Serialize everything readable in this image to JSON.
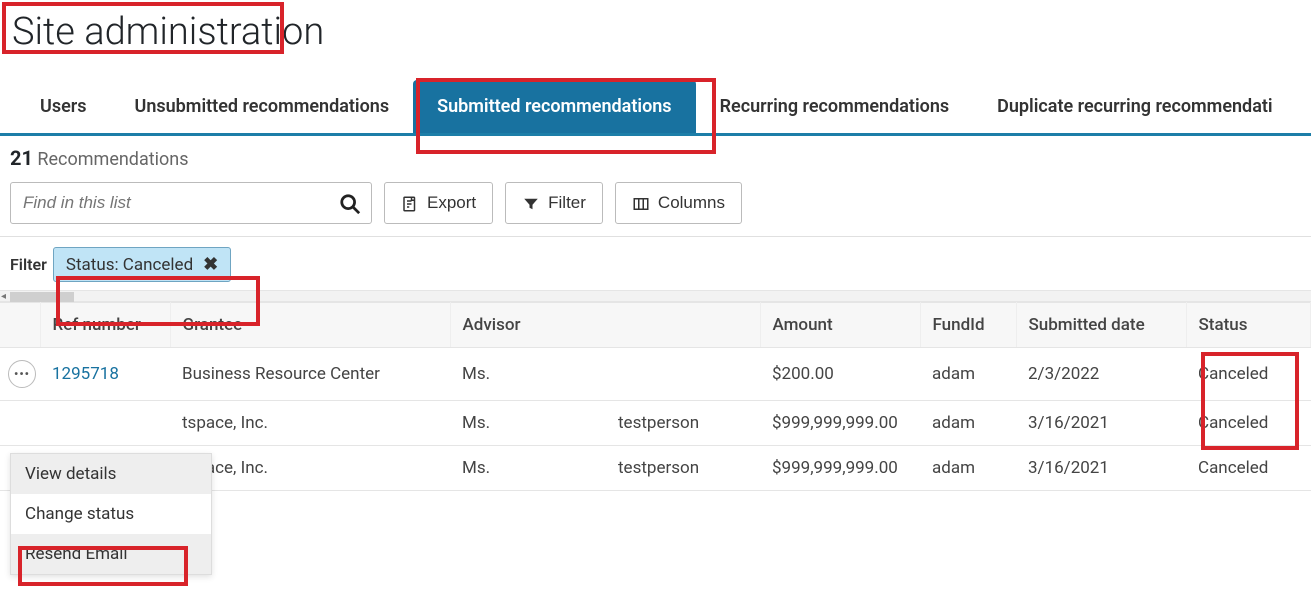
{
  "page": {
    "title": "Site administration"
  },
  "tabs": [
    {
      "label": "Users"
    },
    {
      "label": "Unsubmitted recommendations"
    },
    {
      "label": "Submitted recommendations"
    },
    {
      "label": "Recurring recommendations"
    },
    {
      "label": "Duplicate recurring recommendati"
    }
  ],
  "activeTabIndex": 2,
  "list": {
    "count": "21",
    "countLabel": "Recommendations"
  },
  "toolbar": {
    "searchPlaceholder": "Find in this list",
    "export": "Export",
    "filter": "Filter",
    "columns": "Columns"
  },
  "filters": {
    "label": "Filter",
    "chip": "Status: Canceled"
  },
  "table": {
    "headers": {
      "ref": "Ref number",
      "grantee": "Grantee",
      "advisor": "Advisor",
      "amount": "Amount",
      "fund": "FundId",
      "submitted": "Submitted date",
      "status": "Status"
    },
    "rows": [
      {
        "ref": "1295718",
        "grantee": "Business Resource Center",
        "advisor1": "Ms.",
        "advisor2": "",
        "amount": "$200.00",
        "fund": "adam",
        "submitted": "2/3/2022",
        "status": "Canceled"
      },
      {
        "ref": "",
        "grantee": "tspace, Inc.",
        "advisor1": "Ms.",
        "advisor2": "testperson",
        "amount": "$999,999,999.00",
        "fund": "adam",
        "submitted": "3/16/2021",
        "status": "Canceled"
      },
      {
        "ref": "",
        "grantee": "tspace, Inc.",
        "advisor1": "Ms.",
        "advisor2": "testperson",
        "amount": "$999,999,999.00",
        "fund": "adam",
        "submitted": "3/16/2021",
        "status": "Canceled"
      }
    ]
  },
  "contextMenu": {
    "items": [
      "View details",
      "Change status",
      "Resend Email"
    ]
  }
}
